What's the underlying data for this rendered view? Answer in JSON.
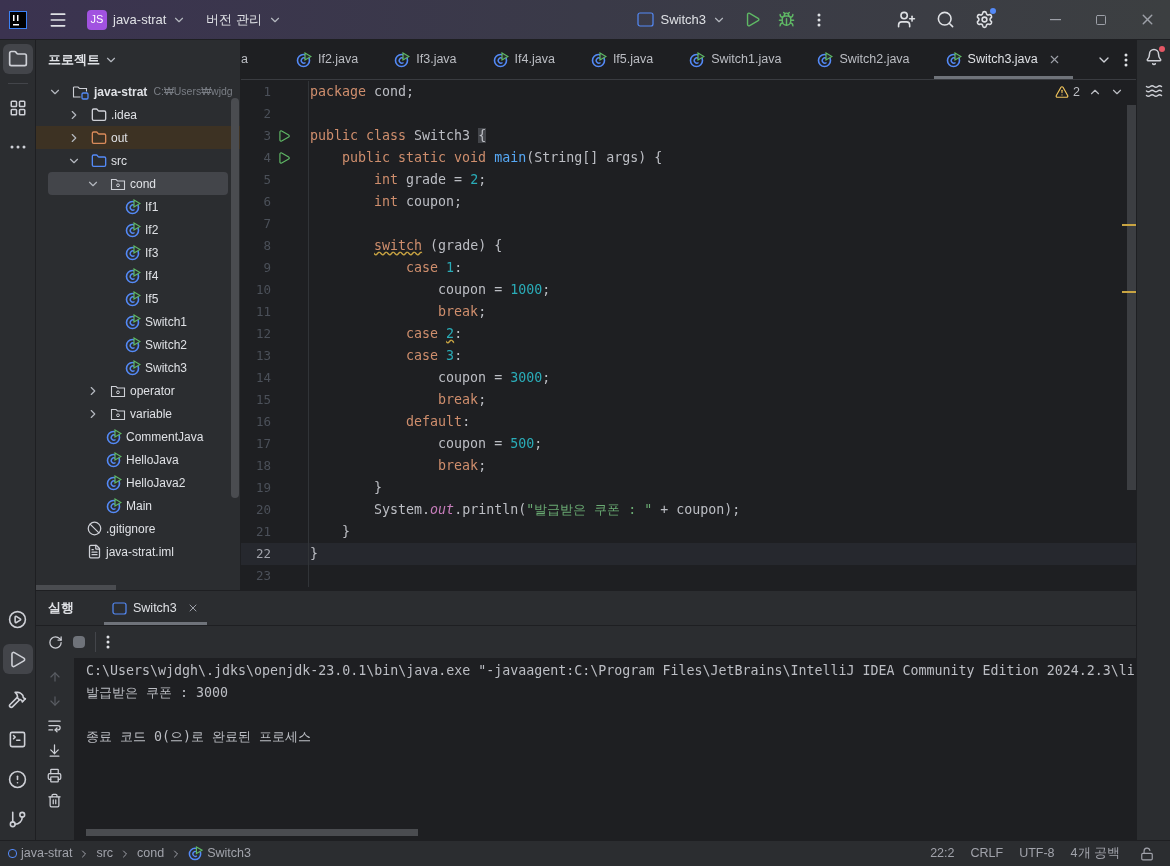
{
  "title_bar": {
    "project_badge": "JS",
    "project": "java-strat",
    "vcs": "버전 관리",
    "run_config": "Switch3"
  },
  "left_tools": [
    {
      "kind": "project",
      "selected": true
    },
    {
      "kind": "structure",
      "selected": false
    },
    {
      "kind": "more",
      "selected": false
    }
  ],
  "bottom_tools": [
    {
      "kind": "services",
      "selected": false
    },
    {
      "kind": "run",
      "selected": true
    },
    {
      "kind": "build",
      "selected": false
    },
    {
      "kind": "terminal",
      "selected": false
    },
    {
      "kind": "problems",
      "selected": false
    },
    {
      "kind": "git",
      "selected": false
    }
  ],
  "project_panel": {
    "title": "프로젝트",
    "tree": [
      {
        "label": "java-strat",
        "path": "C:₩Users₩wjdg",
        "kind": "module",
        "expanded": true,
        "selected": false,
        "children": [
          {
            "label": ".idea",
            "kind": "folder",
            "expanded": false,
            "selected": false
          },
          {
            "label": "out",
            "kind": "excluded",
            "expanded": false,
            "selected": false
          },
          {
            "label": "src",
            "kind": "source",
            "expanded": true,
            "selected": false,
            "children": [
              {
                "label": "cond",
                "kind": "package",
                "expanded": true,
                "selected": true,
                "children": [
                  {
                    "label": "If1",
                    "kind": "class",
                    "selected": false
                  },
                  {
                    "label": "If2",
                    "kind": "class",
                    "selected": false
                  },
                  {
                    "label": "If3",
                    "kind": "class",
                    "selected": false
                  },
                  {
                    "label": "If4",
                    "kind": "class",
                    "selected": false
                  },
                  {
                    "label": "If5",
                    "kind": "class",
                    "selected": false
                  },
                  {
                    "label": "Switch1",
                    "kind": "class",
                    "selected": false
                  },
                  {
                    "label": "Switch2",
                    "kind": "class",
                    "selected": false
                  },
                  {
                    "label": "Switch3",
                    "kind": "class",
                    "selected": false
                  }
                ]
              },
              {
                "label": "operator",
                "kind": "package",
                "expanded": false,
                "selected": false
              },
              {
                "label": "variable",
                "kind": "package",
                "expanded": false,
                "selected": false
              },
              {
                "label": "CommentJava",
                "kind": "class",
                "selected": false
              },
              {
                "label": "HelloJava",
                "kind": "class",
                "selected": false
              },
              {
                "label": "HelloJava2",
                "kind": "class",
                "selected": false
              },
              {
                "label": "Main",
                "kind": "class",
                "selected": false
              }
            ]
          },
          {
            "label": ".gitignore",
            "kind": "ignore",
            "selected": false
          },
          {
            "label": "java-strat.iml",
            "kind": "file",
            "selected": false
          }
        ]
      }
    ]
  },
  "editor_tabs": [
    {
      "label": "a",
      "selected": false,
      "kind": "fragment"
    },
    {
      "label": "If2.java",
      "selected": false,
      "kind": "file"
    },
    {
      "label": "If3.java",
      "selected": false,
      "kind": "file"
    },
    {
      "label": "If4.java",
      "selected": false,
      "kind": "file"
    },
    {
      "label": "If5.java",
      "selected": false,
      "kind": "file"
    },
    {
      "label": "Switch1.java",
      "selected": false,
      "kind": "file"
    },
    {
      "label": "Switch2.java",
      "selected": false,
      "kind": "file"
    },
    {
      "label": "Switch3.java",
      "selected": true,
      "kind": "file"
    }
  ],
  "warnings": "2",
  "code_lines": [
    {
      "number": "1",
      "current": false,
      "tokens": [
        {
          "kind": "kw",
          "text": "package "
        },
        {
          "kind": "plain",
          "text": "cond;"
        }
      ]
    },
    {
      "number": "2",
      "current": false
    },
    {
      "number": "3",
      "current": false,
      "run": true,
      "tokens": [
        {
          "kind": "kw",
          "text": "public class "
        },
        {
          "kind": "plain",
          "text": "Switch3 "
        },
        {
          "kind": "brace",
          "text": "{"
        }
      ]
    },
    {
      "number": "4",
      "current": false,
      "run": true,
      "tokens": [
        {
          "kind": "kw",
          "text": "    public static void "
        },
        {
          "kind": "fn",
          "text": "main"
        },
        {
          "kind": "plain",
          "text": "(String[] args) {"
        }
      ]
    },
    {
      "number": "5",
      "current": false,
      "tokens": [
        {
          "kind": "kw",
          "text": "        int "
        },
        {
          "kind": "plain",
          "text": "grade = "
        },
        {
          "kind": "num",
          "text": "2"
        },
        {
          "kind": "plain",
          "text": ";"
        }
      ]
    },
    {
      "number": "6",
      "current": false,
      "tokens": [
        {
          "kind": "kw",
          "text": "        int "
        },
        {
          "kind": "plain",
          "text": "coupon;"
        }
      ]
    },
    {
      "number": "7",
      "current": false
    },
    {
      "number": "8",
      "current": false,
      "tokens": [
        {
          "kind": "kw",
          "text": "        switch",
          "warning": true
        },
        {
          "kind": "plain",
          "text": " (grade) {"
        }
      ]
    },
    {
      "number": "9",
      "current": false,
      "tokens": [
        {
          "kind": "kw",
          "text": "            case "
        },
        {
          "kind": "num",
          "text": "1"
        },
        {
          "kind": "plain",
          "text": ":"
        }
      ]
    },
    {
      "number": "10",
      "current": false,
      "tokens": [
        {
          "kind": "plain",
          "text": "                coupon = "
        },
        {
          "kind": "num",
          "text": "1000"
        },
        {
          "kind": "plain",
          "text": ";"
        }
      ]
    },
    {
      "number": "11",
      "current": false,
      "tokens": [
        {
          "kind": "kw",
          "text": "                break"
        },
        {
          "kind": "plain",
          "text": ";"
        }
      ]
    },
    {
      "number": "12",
      "current": false,
      "tokens": [
        {
          "kind": "kw",
          "text": "            case "
        },
        {
          "kind": "num",
          "text": "2",
          "warning": true
        },
        {
          "kind": "plain",
          "text": ":"
        }
      ]
    },
    {
      "number": "13",
      "current": false,
      "tokens": [
        {
          "kind": "kw",
          "text": "            case "
        },
        {
          "kind": "num",
          "text": "3"
        },
        {
          "kind": "plain",
          "text": ":"
        }
      ]
    },
    {
      "number": "14",
      "current": false,
      "tokens": [
        {
          "kind": "plain",
          "text": "                coupon = "
        },
        {
          "kind": "num",
          "text": "3000"
        },
        {
          "kind": "plain",
          "text": ";"
        }
      ]
    },
    {
      "number": "15",
      "current": false,
      "tokens": [
        {
          "kind": "kw",
          "text": "                break"
        },
        {
          "kind": "plain",
          "text": ";"
        }
      ]
    },
    {
      "number": "16",
      "current": false,
      "tokens": [
        {
          "kind": "kw",
          "text": "            default"
        },
        {
          "kind": "plain",
          "text": ":"
        }
      ]
    },
    {
      "number": "17",
      "current": false,
      "tokens": [
        {
          "kind": "plain",
          "text": "                coupon = "
        },
        {
          "kind": "num",
          "text": "500"
        },
        {
          "kind": "plain",
          "text": ";"
        }
      ]
    },
    {
      "number": "18",
      "current": false,
      "tokens": [
        {
          "kind": "kw",
          "text": "                break"
        },
        {
          "kind": "plain",
          "text": ";"
        }
      ]
    },
    {
      "number": "19",
      "current": false,
      "tokens": [
        {
          "kind": "plain",
          "text": "        }"
        }
      ]
    },
    {
      "number": "20",
      "current": false,
      "tokens": [
        {
          "kind": "plain",
          "text": "        System."
        },
        {
          "kind": "field",
          "text": "out"
        },
        {
          "kind": "plain",
          "text": ".println("
        },
        {
          "kind": "str",
          "text": "\"발급받은 쿠폰 : \""
        },
        {
          "kind": "plain",
          "text": " + coupon);"
        }
      ]
    },
    {
      "number": "21",
      "current": false,
      "tokens": [
        {
          "kind": "plain",
          "text": "    }"
        }
      ]
    },
    {
      "number": "22",
      "current": true,
      "tokens": [
        {
          "kind": "plain",
          "text": "}"
        }
      ]
    },
    {
      "number": "23",
      "current": false
    }
  ],
  "run_panel": {
    "title": "실행",
    "tabs": [
      {
        "label": "Switch3",
        "selected": true
      }
    ],
    "console": [
      {
        "kind": "text",
        "text": "C:\\Users\\wjdgh\\.jdks\\openjdk-23.0.1\\bin\\java.exe \"-javaagent:C:\\Program Files\\JetBrains\\IntelliJ IDEA Community Edition 2024.2.3\\li"
      },
      {
        "kind": "text",
        "text": "발급받은 쿠폰 : 3000"
      },
      {
        "kind": "blank"
      },
      {
        "kind": "text",
        "text": "종료 코드 0(으)로 완료된 프로세스"
      }
    ]
  },
  "status_bar": {
    "breadcrumbs": [
      "java-strat",
      "src",
      "cond",
      "Switch3"
    ],
    "items": [
      "22:2",
      "CRLF",
      "UTF-8",
      "4개 공백"
    ]
  }
}
